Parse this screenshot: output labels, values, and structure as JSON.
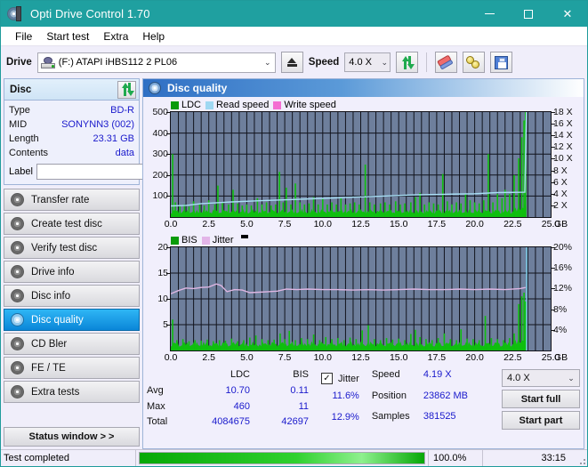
{
  "window": {
    "title": "Opti Drive Control 1.70",
    "icon": "optical-disc-icon",
    "minimize": "minimize-icon",
    "maximize": "maximize-icon",
    "close": "close-icon",
    "titlebar_color": "#1fa0a0"
  },
  "menu": {
    "items": [
      "File",
      "Start test",
      "Extra",
      "Help"
    ]
  },
  "toolbar": {
    "drive_label": "Drive",
    "drive_value": "(F:)  ATAPI iHBS112  2 PL06",
    "eject_label": "eject-icon",
    "speed_label": "Speed",
    "speed_value": "4.0 X",
    "refresh_icon": "refresh-icon",
    "erase_icon": "eraser-icon",
    "tools_icon": "disc-tools-icon",
    "save_icon": "save-icon"
  },
  "disc_panel": {
    "title": "Disc",
    "refresh_icon": "refresh-icon",
    "rows": [
      {
        "key": "Type",
        "value": "BD-R"
      },
      {
        "key": "MID",
        "value": "SONYNN3 (002)"
      },
      {
        "key": "Length",
        "value": "23.31 GB"
      },
      {
        "key": "Contents",
        "value": "data"
      }
    ],
    "label_key": "Label",
    "label_value": "",
    "label_placeholder": "",
    "label_button_icon": "disc-icon"
  },
  "nav": {
    "items": [
      {
        "label": "Transfer rate",
        "active": false
      },
      {
        "label": "Create test disc",
        "active": false
      },
      {
        "label": "Verify test disc",
        "active": false
      },
      {
        "label": "Drive info",
        "active": false
      },
      {
        "label": "Disc info",
        "active": false
      },
      {
        "label": "Disc quality",
        "active": true
      },
      {
        "label": "CD Bler",
        "active": false
      },
      {
        "label": "FE / TE",
        "active": false
      },
      {
        "label": "Extra tests",
        "active": false
      }
    ],
    "status_window": "Status window > >"
  },
  "panel": {
    "header_title": "Disc quality",
    "header_icon": "disc-quality-icon"
  },
  "chart_data": [
    {
      "type": "area",
      "id": "ldc-chart",
      "title": "",
      "xlabel": "GB",
      "ylabel": "",
      "xlim": [
        0,
        25
      ],
      "ylim": [
        0,
        500
      ],
      "y2lim": [
        0,
        18
      ],
      "grid": true,
      "legend_position": "top-left",
      "legend": [
        {
          "name": "LDC",
          "color": "#0a9b0a"
        },
        {
          "name": "Read speed",
          "color": "#9fd8f2"
        },
        {
          "name": "Write speed",
          "color": "#f46ed2"
        }
      ],
      "xticks": [
        "0.0",
        "2.5",
        "5.0",
        "7.5",
        "10.0",
        "12.5",
        "15.0",
        "17.5",
        "20.0",
        "22.5",
        "25.0"
      ],
      "yticks": [
        100,
        200,
        300,
        400,
        500
      ],
      "y2ticks": [
        "2 X",
        "4 X",
        "6 X",
        "8 X",
        "10 X",
        "12 X",
        "14 X",
        "16 X",
        "18 X"
      ],
      "xunit": "GB",
      "series": [
        {
          "name": "LDC",
          "type": "spikes",
          "color": "#0fbf0f",
          "x_end": 23.4,
          "baseline": 30,
          "spikes": [
            [
              0.12,
              300
            ],
            [
              0.3,
              70
            ],
            [
              0.6,
              55
            ],
            [
              0.9,
              60
            ],
            [
              1.2,
              50
            ],
            [
              1.5,
              75
            ],
            [
              1.9,
              60
            ],
            [
              2.2,
              55
            ],
            [
              2.5,
              80
            ],
            [
              2.9,
              60
            ],
            [
              3.1,
              150
            ],
            [
              3.4,
              70
            ],
            [
              3.8,
              60
            ],
            [
              4.1,
              130
            ],
            [
              4.4,
              65
            ],
            [
              4.7,
              55
            ],
            [
              5.0,
              60
            ],
            [
              5.3,
              55
            ],
            [
              5.7,
              90
            ],
            [
              6.0,
              60
            ],
            [
              6.3,
              70
            ],
            [
              6.6,
              55
            ],
            [
              6.9,
              60
            ],
            [
              7.15,
              215
            ],
            [
              7.4,
              70
            ],
            [
              7.6,
              140
            ],
            [
              7.9,
              60
            ],
            [
              8.2,
              160
            ],
            [
              8.5,
              70
            ],
            [
              8.8,
              60
            ],
            [
              9.1,
              65
            ],
            [
              9.4,
              95
            ],
            [
              9.7,
              60
            ],
            [
              10.0,
              90
            ],
            [
              10.3,
              60
            ],
            [
              10.6,
              70
            ],
            [
              10.9,
              60
            ],
            [
              11.2,
              95
            ],
            [
              11.5,
              60
            ],
            [
              11.8,
              65
            ],
            [
              12.1,
              70
            ],
            [
              12.4,
              60
            ],
            [
              12.8,
              250
            ],
            [
              13.1,
              70
            ],
            [
              13.4,
              60
            ],
            [
              13.8,
              65
            ],
            [
              14.1,
              70
            ],
            [
              14.4,
              60
            ],
            [
              14.8,
              75
            ],
            [
              15.1,
              60
            ],
            [
              15.4,
              65
            ],
            [
              15.8,
              70
            ],
            [
              16.1,
              95
            ],
            [
              16.4,
              115
            ],
            [
              16.7,
              60
            ],
            [
              17.0,
              70
            ],
            [
              17.3,
              65
            ],
            [
              17.6,
              60
            ],
            [
              17.9,
              205
            ],
            [
              18.2,
              75
            ],
            [
              18.5,
              60
            ],
            [
              18.8,
              70
            ],
            [
              19.1,
              65
            ],
            [
              19.4,
              110
            ],
            [
              19.7,
              80
            ],
            [
              20.0,
              70
            ],
            [
              20.3,
              65
            ],
            [
              20.6,
              80
            ],
            [
              20.9,
              300
            ],
            [
              21.2,
              70
            ],
            [
              21.5,
              110
            ],
            [
              21.8,
              90
            ],
            [
              22.0,
              130
            ],
            [
              22.3,
              110
            ],
            [
              22.6,
              200
            ],
            [
              22.9,
              280
            ],
            [
              23.1,
              380
            ],
            [
              23.25,
              460
            ],
            [
              23.35,
              500
            ]
          ]
        },
        {
          "name": "Read speed",
          "type": "line",
          "color": "#a8dff5",
          "points": [
            [
              0.0,
              1.9
            ],
            [
              1.0,
              2.0
            ],
            [
              2.0,
              2.3
            ],
            [
              4.0,
              2.6
            ],
            [
              6.0,
              2.8
            ],
            [
              8.0,
              3.0
            ],
            [
              10.0,
              3.2
            ],
            [
              12.0,
              3.4
            ],
            [
              14.0,
              3.6
            ],
            [
              16.0,
              3.8
            ],
            [
              18.0,
              3.9
            ],
            [
              20.0,
              4.0
            ],
            [
              21.5,
              4.2
            ],
            [
              23.3,
              4.25
            ],
            [
              23.4,
              18.0
            ]
          ]
        }
      ]
    },
    {
      "type": "area",
      "id": "bis-chart",
      "title": "",
      "xlabel": "GB",
      "ylabel": "",
      "xlim": [
        0,
        25
      ],
      "ylim": [
        0,
        20
      ],
      "y2lim": [
        0,
        20
      ],
      "grid": true,
      "legend_position": "top-left",
      "legend": [
        {
          "name": "BIS",
          "color": "#0a9b0a"
        },
        {
          "name": "Jitter",
          "color": "#e3b5e8"
        }
      ],
      "xticks": [
        "0.0",
        "2.5",
        "5.0",
        "7.5",
        "10.0",
        "12.5",
        "15.0",
        "17.5",
        "20.0",
        "22.5",
        "25.0"
      ],
      "yticks": [
        5,
        10,
        15,
        20
      ],
      "y2ticks": [
        "4%",
        "8%",
        "12%",
        "16%",
        "20%"
      ],
      "xunit": "GB",
      "series": [
        {
          "name": "BIS",
          "type": "spikes",
          "color": "#0fbf0f",
          "x_end": 23.4,
          "baseline": 1.4,
          "spikes": [
            [
              0.12,
              6.0
            ],
            [
              0.4,
              2.0
            ],
            [
              0.8,
              2.2
            ],
            [
              1.2,
              1.8
            ],
            [
              1.6,
              2.0
            ],
            [
              2.0,
              1.9
            ],
            [
              2.4,
              2.1
            ],
            [
              2.8,
              1.8
            ],
            [
              3.2,
              2.0
            ],
            [
              3.6,
              1.9
            ],
            [
              4.0,
              2.3
            ],
            [
              4.4,
              1.8
            ],
            [
              4.8,
              2.0
            ],
            [
              5.2,
              2.5
            ],
            [
              5.6,
              2.9
            ],
            [
              6.0,
              2.2
            ],
            [
              6.4,
              2.0
            ],
            [
              6.8,
              2.1
            ],
            [
              7.2,
              3.3
            ],
            [
              7.5,
              2.2
            ],
            [
              7.8,
              3.8
            ],
            [
              8.2,
              2.0
            ],
            [
              8.6,
              2.4
            ],
            [
              9.0,
              2.2
            ],
            [
              9.4,
              3.1
            ],
            [
              9.8,
              2.0
            ],
            [
              10.2,
              2.6
            ],
            [
              10.6,
              2.2
            ],
            [
              11.0,
              2.4
            ],
            [
              11.4,
              2.0
            ],
            [
              11.8,
              2.5
            ],
            [
              12.2,
              2.2
            ],
            [
              12.6,
              3.9
            ],
            [
              13.0,
              4.9
            ],
            [
              13.4,
              2.2
            ],
            [
              13.8,
              2.0
            ],
            [
              14.2,
              2.4
            ],
            [
              14.6,
              2.1
            ],
            [
              15.0,
              2.3
            ],
            [
              15.4,
              2.0
            ],
            [
              15.8,
              3.2
            ],
            [
              16.1,
              4.0
            ],
            [
              16.4,
              2.6
            ],
            [
              16.8,
              2.2
            ],
            [
              17.2,
              2.0
            ],
            [
              17.6,
              2.4
            ],
            [
              18.0,
              3.3
            ],
            [
              18.4,
              2.2
            ],
            [
              18.8,
              2.0
            ],
            [
              19.1,
              4.1
            ],
            [
              19.5,
              2.3
            ],
            [
              19.9,
              2.2
            ],
            [
              20.3,
              2.0
            ],
            [
              20.7,
              6.7
            ],
            [
              21.1,
              2.4
            ],
            [
              21.5,
              2.2
            ],
            [
              21.9,
              2.0
            ],
            [
              22.3,
              2.4
            ],
            [
              22.6,
              3.3
            ],
            [
              22.9,
              9.0
            ],
            [
              23.1,
              10.5
            ],
            [
              23.25,
              11.2
            ],
            [
              23.35,
              9.5
            ]
          ]
        },
        {
          "name": "Jitter",
          "type": "line",
          "color": "#deb6e2",
          "points": [
            [
              0.0,
              11.0
            ],
            [
              0.5,
              11.6
            ],
            [
              1.0,
              12.1
            ],
            [
              1.5,
              12.0
            ],
            [
              2.0,
              12.2
            ],
            [
              2.5,
              12.3
            ],
            [
              3.0,
              12.9
            ],
            [
              3.3,
              12.6
            ],
            [
              3.7,
              11.4
            ],
            [
              4.2,
              11.8
            ],
            [
              4.7,
              11.7
            ],
            [
              5.2,
              11.2
            ],
            [
              5.8,
              11.3
            ],
            [
              6.4,
              11.4
            ],
            [
              7.0,
              11.5
            ],
            [
              7.6,
              11.9
            ],
            [
              8.3,
              11.8
            ],
            [
              9.0,
              11.9
            ],
            [
              10.0,
              11.8
            ],
            [
              11.0,
              11.8
            ],
            [
              12.0,
              11.7
            ],
            [
              13.0,
              11.8
            ],
            [
              14.0,
              11.7
            ],
            [
              15.0,
              11.8
            ],
            [
              16.0,
              11.9
            ],
            [
              17.0,
              11.8
            ],
            [
              18.0,
              11.8
            ],
            [
              19.0,
              11.9
            ],
            [
              20.0,
              11.8
            ],
            [
              21.0,
              11.9
            ],
            [
              22.0,
              11.8
            ],
            [
              23.0,
              12.0
            ],
            [
              23.35,
              12.2
            ]
          ]
        },
        {
          "name": "Speed marker",
          "type": "line",
          "color": "#7fd4f0",
          "points": [
            [
              23.42,
              0
            ],
            [
              23.42,
              20
            ]
          ]
        }
      ]
    }
  ],
  "stats": {
    "col_headers": [
      "LDC",
      "BIS"
    ],
    "row_headers": [
      "Avg",
      "Max",
      "Total"
    ],
    "ldc": {
      "avg": "10.70",
      "max": "460",
      "total": "4084675"
    },
    "bis": {
      "avg": "0.11",
      "max": "11",
      "total": "42697"
    },
    "jitter": {
      "label": "Jitter",
      "checked": true,
      "avg": "11.6%",
      "max": "12.9%"
    },
    "speed_label": "Speed",
    "speed_value": "4.19 X",
    "position_label": "Position",
    "position_value": "23862 MB",
    "samples_label": "Samples",
    "samples_value": "381525",
    "speed_select": "4.0 X",
    "start_full": "Start full",
    "start_part": "Start part"
  },
  "statusbar": {
    "text": "Test completed",
    "progress_percent": "100.0%",
    "progress_value": 100,
    "elapsed": "33:15"
  }
}
